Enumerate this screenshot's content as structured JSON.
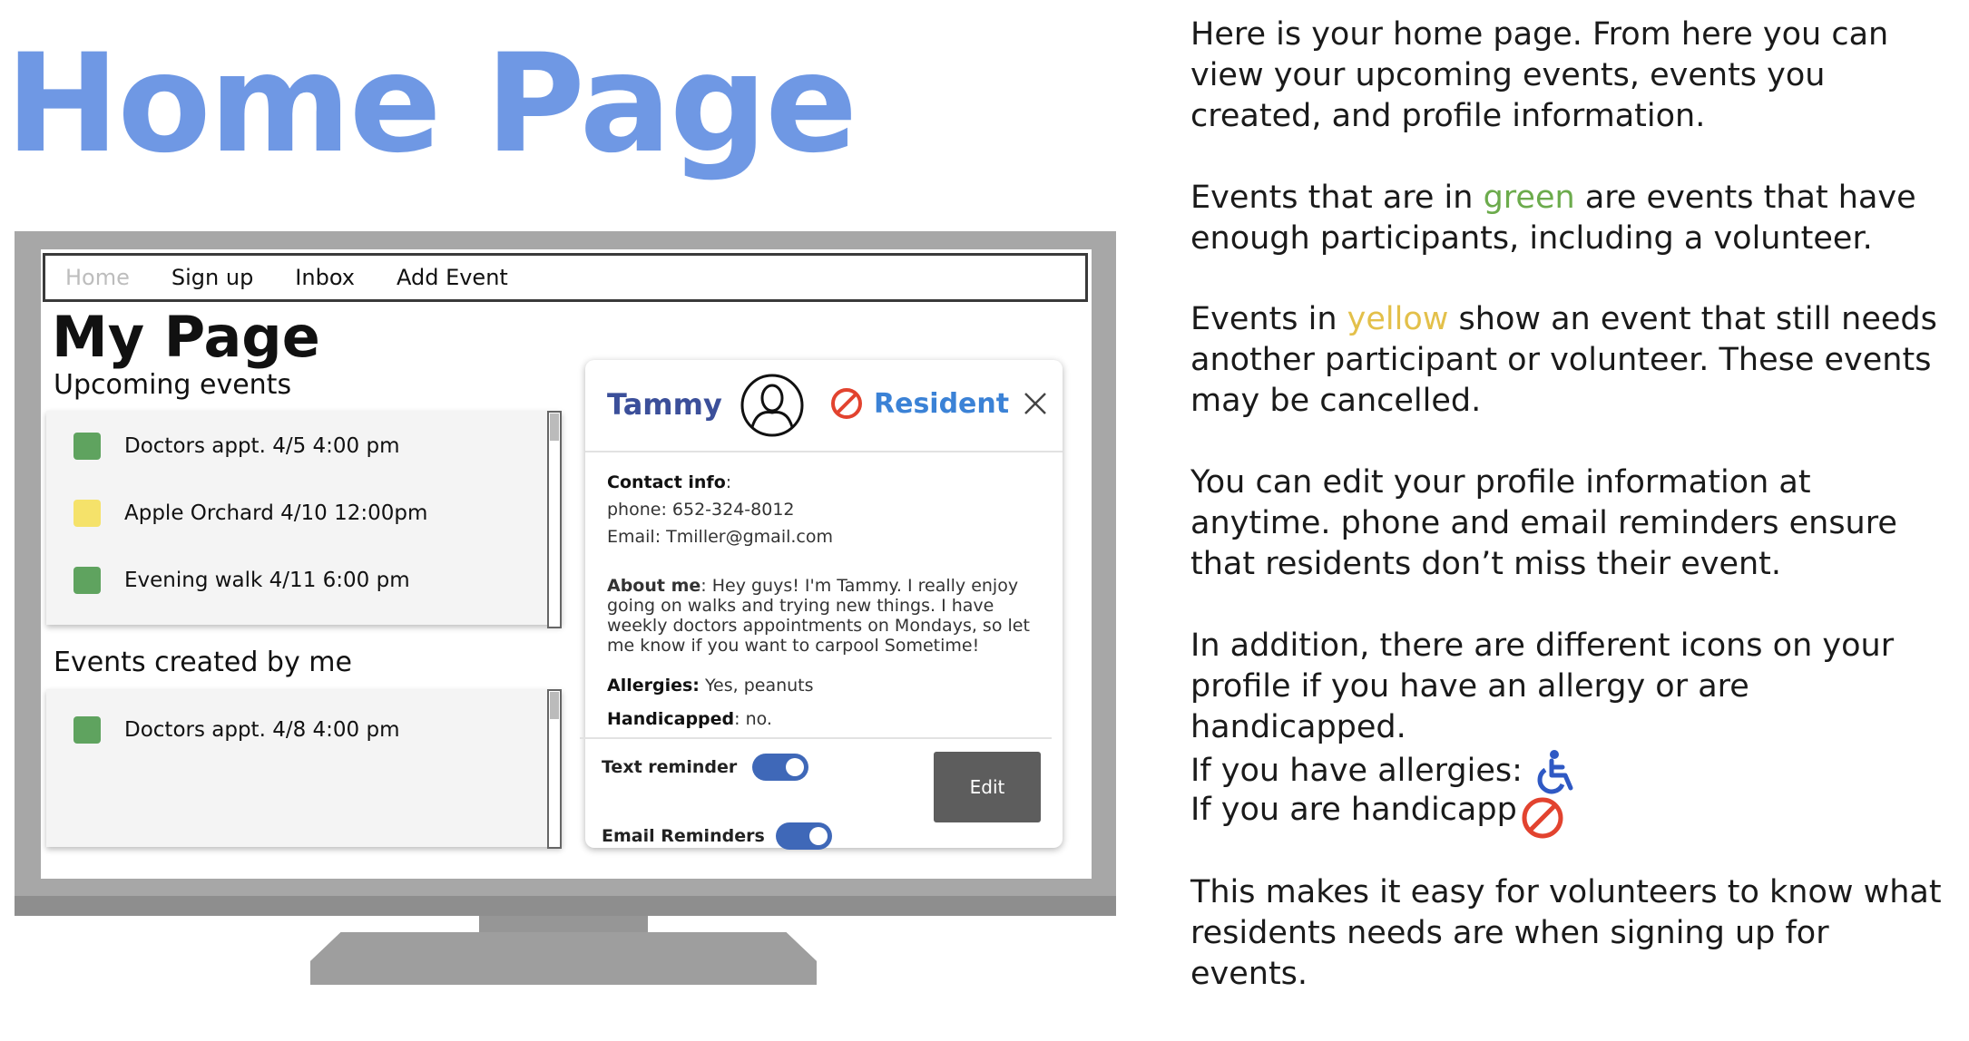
{
  "page": {
    "title": "Home Page"
  },
  "app": {
    "nav": {
      "items": [
        "Home",
        "Sign up",
        "Inbox",
        "Add Event"
      ]
    },
    "heading": "My Page",
    "upcoming": {
      "label": "Upcoming events",
      "events": [
        {
          "text": "Doctors appt. 4/5 4:00 pm",
          "color": "#5fa35f"
        },
        {
          "text": "Apple Orchard 4/10 12:00pm",
          "color": "#f5e26a"
        },
        {
          "text": "Evening walk 4/11 6:00 pm",
          "color": "#5fa35f"
        }
      ]
    },
    "created": {
      "label": "Events created by me",
      "events": [
        {
          "text": "Doctors appt. 4/8  4:00 pm",
          "color": "#5fa35f"
        }
      ]
    },
    "profile": {
      "name": "Tammy",
      "role": "Resident",
      "contact_label": "Contact info",
      "phone": "phone: 652-324-8012",
      "email": "Email: Tmiller@gmail.com",
      "about_label": "About me",
      "about_text": ": Hey guys! I'm Tammy. I really enjoy going on walks and trying new things. I have weekly doctors appointments on Mondays, so let me know if you want to carpool Sometime!",
      "allergies_label": "Allergies:",
      "allergies_value": " Yes, peanuts",
      "handicapped_label": "Handicapped",
      "handicapped_value": ": no.",
      "text_reminder_label": "Text reminder",
      "email_reminder_label": "Email Reminders",
      "edit_label": "Edit",
      "accent_color": "#3f68b8"
    }
  },
  "description": {
    "p1": "Here is your home page. From here you can view your upcoming events, events you created, and profile information.",
    "p2_pre": "Events that are in ",
    "p2_color_word": "green",
    "p2_post": " are events that have enough participants, including a volunteer.",
    "p3_pre": "Events in ",
    "p3_color_word": "yellow",
    "p3_post": " show an event that still needs another participant or volunteer. These events may be cancelled.",
    "p4": "You can edit your profile information at anytime. phone and email reminders ensure that residents don’t miss their event.",
    "p5": "In addition, there are different icons on your profile if you have an allergy or are handicapped.",
    "allergies_line": "If you have allergies:",
    "handicapped_line": "If you are handicappe",
    "p6": "This makes it easy for volunteers to know what residents needs are when signing up for events."
  },
  "colors": {
    "title_blue": "#6f98e4",
    "green": "#6cab4c",
    "yellow": "#e3c04a"
  },
  "icons": [
    "avatar-icon",
    "prohibited-icon",
    "close-icon",
    "wheelchair-icon"
  ]
}
